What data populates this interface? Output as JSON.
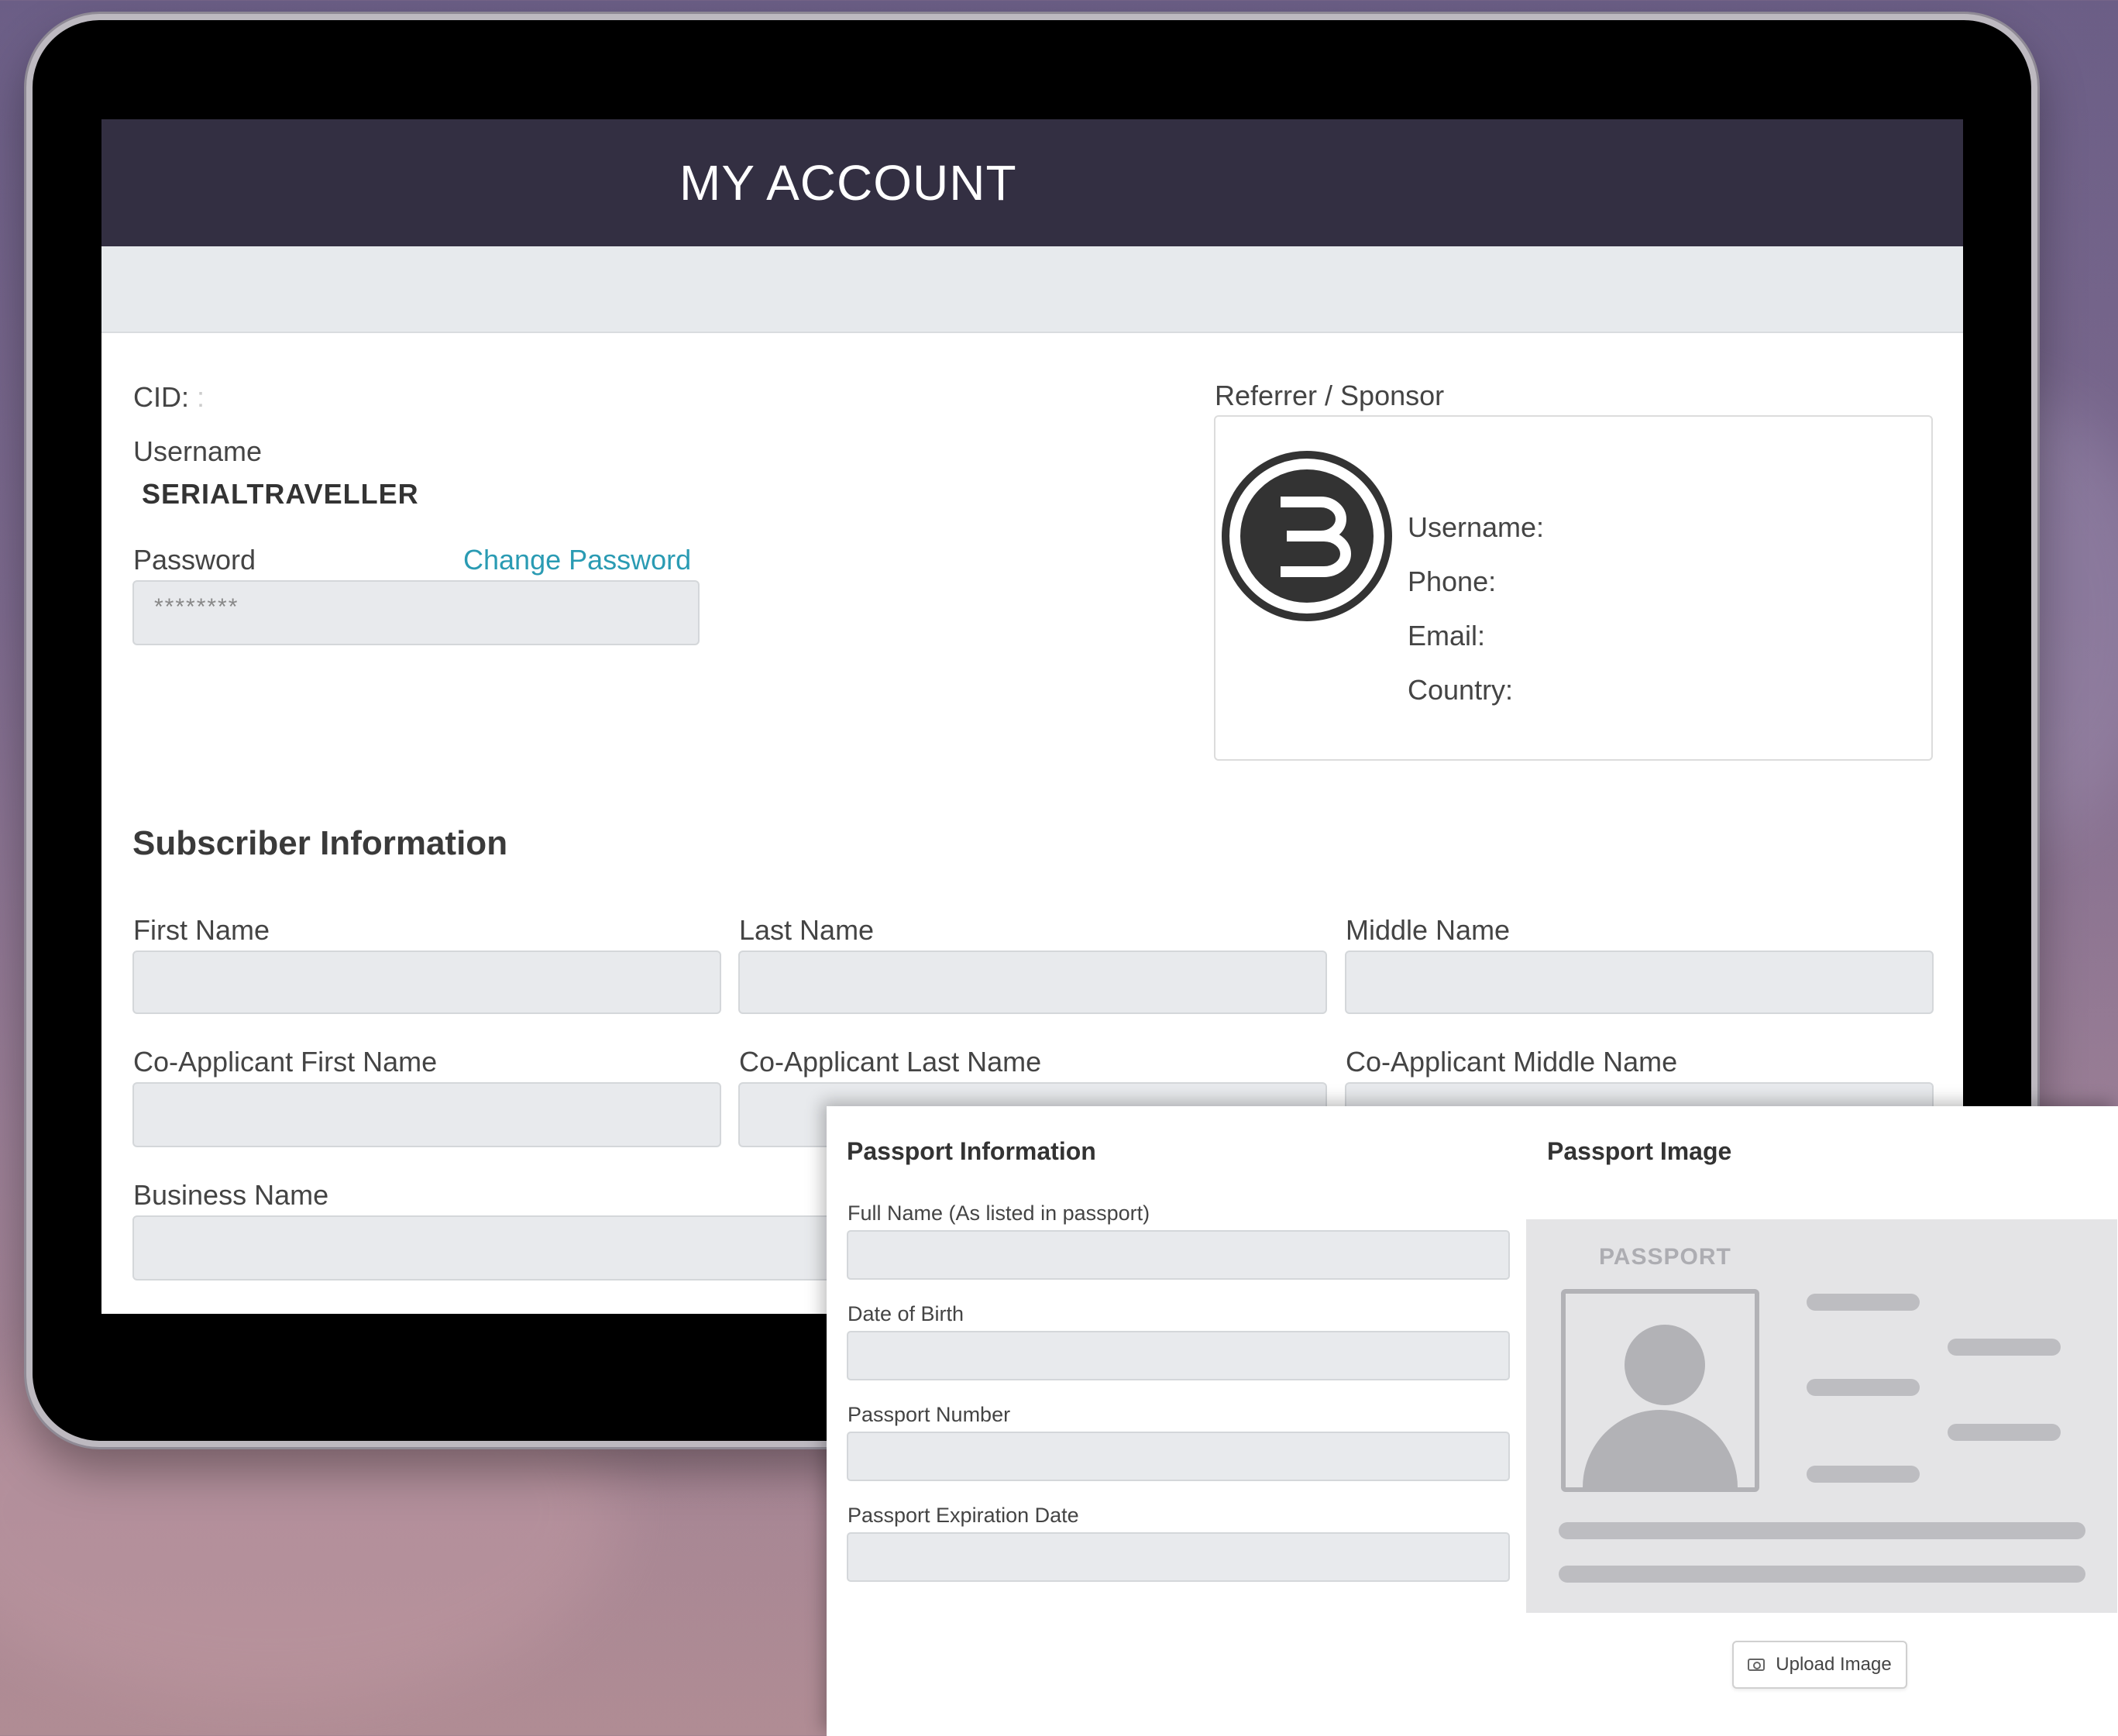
{
  "header": {
    "title": "MY ACCOUNT"
  },
  "account": {
    "cid_label": "CID:",
    "cid_value": ":",
    "username_label": "Username",
    "username_value": "SERIALTRAVELLER",
    "password_label": "Password",
    "change_password_link": "Change Password",
    "password_mask": "********"
  },
  "referrer": {
    "title": "Referrer / Sponsor",
    "logo_icon": "brand-b-logo",
    "username_label": "Username:",
    "phone_label": "Phone:",
    "email_label": "Email:",
    "country_label": "Country:"
  },
  "subscriber": {
    "title": "Subscriber Information",
    "first_name": "First Name",
    "last_name": "Last Name",
    "middle_name": "Middle Name",
    "co_first_name": "Co-Applicant First Name",
    "co_last_name": "Co-Applicant Last Name",
    "co_middle_name": "Co-Applicant Middle Name",
    "business_name": "Business Name"
  },
  "passport": {
    "info_title": "Passport Information",
    "image_title": "Passport Image",
    "full_name": "Full Name (As listed in passport)",
    "dob": "Date of Birth",
    "number": "Passport Number",
    "expiration": "Passport Expiration Date",
    "placeholder_label": "PASSPORT",
    "upload_button": "Upload Image",
    "upload_icon": "camera-icon"
  },
  "colors": {
    "header_bg": "#332f42",
    "link": "#2a9bb3",
    "field_bg": "#e8eaed"
  }
}
